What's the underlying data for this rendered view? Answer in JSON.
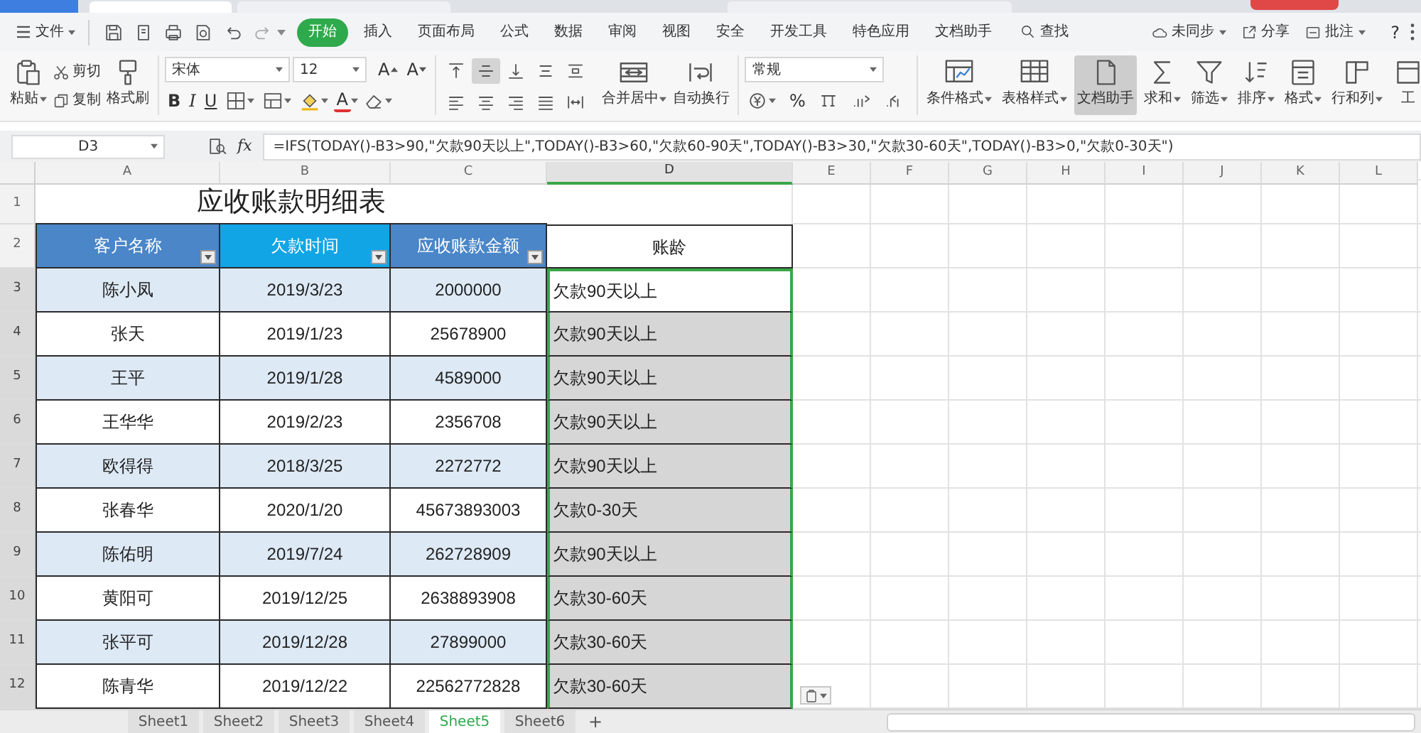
{
  "title_bar": {
    "tabs": [
      {
        "selected": true
      },
      {
        "selected": false
      },
      {
        "selected": false
      }
    ]
  },
  "menu_bar": {
    "file_menu": "文件",
    "tabs": [
      {
        "label": "开始",
        "selected": true
      },
      {
        "label": "插入",
        "selected": false
      },
      {
        "label": "页面布局",
        "selected": false
      },
      {
        "label": "公式",
        "selected": false
      },
      {
        "label": "数据",
        "selected": false
      },
      {
        "label": "审阅",
        "selected": false
      },
      {
        "label": "视图",
        "selected": false
      },
      {
        "label": "安全",
        "selected": false
      },
      {
        "label": "开发工具",
        "selected": false
      },
      {
        "label": "特色应用",
        "selected": false
      },
      {
        "label": "文档助手",
        "selected": false
      }
    ],
    "search": "查找",
    "actions": [
      {
        "label": "未同步",
        "caret": true
      },
      {
        "label": "分享",
        "caret": false
      },
      {
        "label": "批注",
        "caret": true
      }
    ],
    "help": "?"
  },
  "ribbon": {
    "clipboard": [
      {
        "kind": "large",
        "label": "粘贴",
        "caret": true
      },
      {
        "kind": "small",
        "label": "剪切",
        "caret": false
      },
      {
        "kind": "small",
        "label": "复制",
        "caret": false
      },
      {
        "kind": "large",
        "label": "格式刷",
        "caret": false
      }
    ],
    "font": {
      "name": "宋体",
      "size": "12",
      "size_buttons": [
        "A",
        "A"
      ],
      "styles": [
        "B",
        "I",
        "U"
      ],
      "tools": [
        {
          "kind": "icon",
          "caret": true
        },
        {
          "kind": "icon",
          "caret": true
        },
        {
          "kind": "icon",
          "caret": true
        },
        {
          "kind": "letter",
          "label": "A",
          "caret": true
        },
        {
          "kind": "icon",
          "caret": true
        }
      ]
    },
    "alignment": {
      "buttons": [
        {
          "selected": false
        },
        {
          "selected": true
        },
        {
          "selected": false
        },
        {
          "selected": false
        },
        {
          "selected": false
        },
        {
          "selected": false
        },
        {
          "selected": false
        },
        {
          "selected": false
        },
        {
          "selected": false
        },
        {
          "selected": false
        }
      ],
      "large": [
        {
          "label": "合并居中",
          "caret": true
        },
        {
          "label": "自动换行",
          "caret": false
        }
      ]
    },
    "number": {
      "format": "常规",
      "tools": [
        {
          "kind": "icon",
          "caret": true
        },
        {
          "kind": "letter",
          "label": "%",
          "caret": false
        },
        {
          "kind": "icon",
          "caret": false
        },
        {
          "kind": "icon",
          "caret": false
        },
        {
          "kind": "icon",
          "caret": false
        }
      ]
    },
    "commands": [
      {
        "label": "条件格式",
        "caret": true,
        "selected": false
      },
      {
        "label": "表格样式",
        "caret": true,
        "selected": false
      },
      {
        "label": "文档助手",
        "caret": false,
        "selected": true
      },
      {
        "label": "求和",
        "caret": true,
        "selected": false
      },
      {
        "label": "筛选",
        "caret": true,
        "selected": false
      },
      {
        "label": "排序",
        "caret": true,
        "selected": false
      },
      {
        "label": "格式",
        "caret": true,
        "selected": false
      },
      {
        "label": "行和列",
        "caret": true,
        "selected": false
      },
      {
        "label": "工",
        "caret": false,
        "selected": false
      }
    ]
  },
  "formula_bar": {
    "cell_reference": "D3",
    "function_label": "fx",
    "formula": "=IFS(TODAY()-B3>90,\"欠款90天以上\",TODAY()-B3>60,\"欠款60-90天\",TODAY()-B3>30,\"欠款30-60天\",TODAY()-B3>0,\"欠款0-30天\")"
  },
  "sheet": {
    "columns": [
      {
        "label": "A",
        "selected": false
      },
      {
        "label": "B",
        "selected": false
      },
      {
        "label": "C",
        "selected": false
      },
      {
        "label": "D",
        "selected": true
      },
      {
        "label": "E",
        "selected": false
      },
      {
        "label": "F",
        "selected": false
      },
      {
        "label": "G",
        "selected": false
      },
      {
        "label": "H",
        "selected": false
      },
      {
        "label": "I",
        "selected": false
      },
      {
        "label": "J",
        "selected": false
      },
      {
        "label": "K",
        "selected": false
      },
      {
        "label": "L",
        "selected": false
      }
    ],
    "rows": [
      {
        "label": "1",
        "selected": false
      },
      {
        "label": "2",
        "selected": false
      },
      {
        "label": "3",
        "selected": true
      },
      {
        "label": "4",
        "selected": true
      },
      {
        "label": "5",
        "selected": true
      },
      {
        "label": "6",
        "selected": true
      },
      {
        "label": "7",
        "selected": true
      },
      {
        "label": "8",
        "selected": true
      },
      {
        "label": "9",
        "selected": true
      },
      {
        "label": "10",
        "selected": true
      },
      {
        "label": "11",
        "selected": true
      },
      {
        "label": "12",
        "selected": true
      }
    ],
    "title": "应收账款明细表",
    "headers": [
      {
        "text": "客户名称",
        "filter": true,
        "color": "#4a86c8"
      },
      {
        "text": "欠款时间",
        "filter": true,
        "color": "#12a5e6"
      },
      {
        "text": "应收账款金额",
        "filter": true,
        "color": "#4a86c8"
      },
      {
        "text": "账龄",
        "filter": false,
        "color": "#ffffff"
      }
    ],
    "records": [
      {
        "customer": "陈小凤",
        "date": "2019/3/23",
        "amount": "2000000",
        "aging": "欠款90天以上",
        "selected": true,
        "active": true
      },
      {
        "customer": "张天",
        "date": "2019/1/23",
        "amount": "25678900",
        "aging": "欠款90天以上",
        "selected": true,
        "active": false
      },
      {
        "customer": "王平",
        "date": "2019/1/28",
        "amount": "4589000",
        "aging": "欠款90天以上",
        "selected": true,
        "active": false
      },
      {
        "customer": "王华华",
        "date": "2019/2/23",
        "amount": "2356708",
        "aging": "欠款90天以上",
        "selected": true,
        "active": false
      },
      {
        "customer": "欧得得",
        "date": "2018/3/25",
        "amount": "2272772",
        "aging": "欠款90天以上",
        "selected": true,
        "active": false
      },
      {
        "customer": "张春华",
        "date": "2020/1/20",
        "amount": "45673893003",
        "aging": "欠款0-30天",
        "selected": true,
        "active": false
      },
      {
        "customer": "陈佑明",
        "date": "2019/7/24",
        "amount": "262728909",
        "aging": "欠款90天以上",
        "selected": true,
        "active": false
      },
      {
        "customer": "黄阳可",
        "date": "2019/12/25",
        "amount": "2638893908",
        "aging": "欠款30-60天",
        "selected": true,
        "active": false
      },
      {
        "customer": "张平可",
        "date": "2019/12/28",
        "amount": "27899000",
        "aging": "欠款30-60天",
        "selected": true,
        "active": false
      },
      {
        "customer": "陈青华",
        "date": "2019/12/22",
        "amount": "22562772828",
        "aging": "欠款30-60天",
        "selected": true,
        "active": false
      }
    ],
    "paste_options": true
  },
  "sheet_tabs": [
    {
      "label": "Sheet1",
      "selected": false
    },
    {
      "label": "Sheet2",
      "selected": false
    },
    {
      "label": "Sheet3",
      "selected": false
    },
    {
      "label": "Sheet4",
      "selected": false
    },
    {
      "label": "Sheet5",
      "selected": true
    },
    {
      "label": "Sheet6",
      "selected": false
    }
  ],
  "new_sheet": "+"
}
